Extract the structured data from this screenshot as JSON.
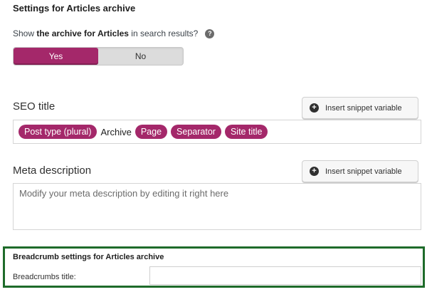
{
  "section": {
    "heading": "Settings for Articles archive"
  },
  "archive_question": {
    "prefix": "Show ",
    "bold": "the archive for Articles",
    "suffix": " in search results?",
    "help_icon": "question-circle-icon"
  },
  "toggle": {
    "yes_label": "Yes",
    "no_label": "No",
    "selected": "Yes"
  },
  "seo_title": {
    "label": "SEO title",
    "insert_button_label": "Insert snippet variable",
    "tokens": [
      {
        "text": "Post type (plural)",
        "type": "pill"
      },
      {
        "text": "Archive",
        "type": "text"
      },
      {
        "text": "Page",
        "type": "pill"
      },
      {
        "text": "Separator",
        "type": "pill"
      },
      {
        "text": "Site title",
        "type": "pill"
      }
    ]
  },
  "meta_description": {
    "label": "Meta description",
    "insert_button_label": "Insert snippet variable",
    "placeholder": "Modify your meta description by editing it right here"
  },
  "breadcrumb": {
    "heading": "Breadcrumb settings for Articles archive",
    "title_label": "Breadcrumbs title:",
    "title_value": ""
  },
  "colors": {
    "accent": "#a4286a",
    "highlight_border": "#1e6b2a"
  }
}
